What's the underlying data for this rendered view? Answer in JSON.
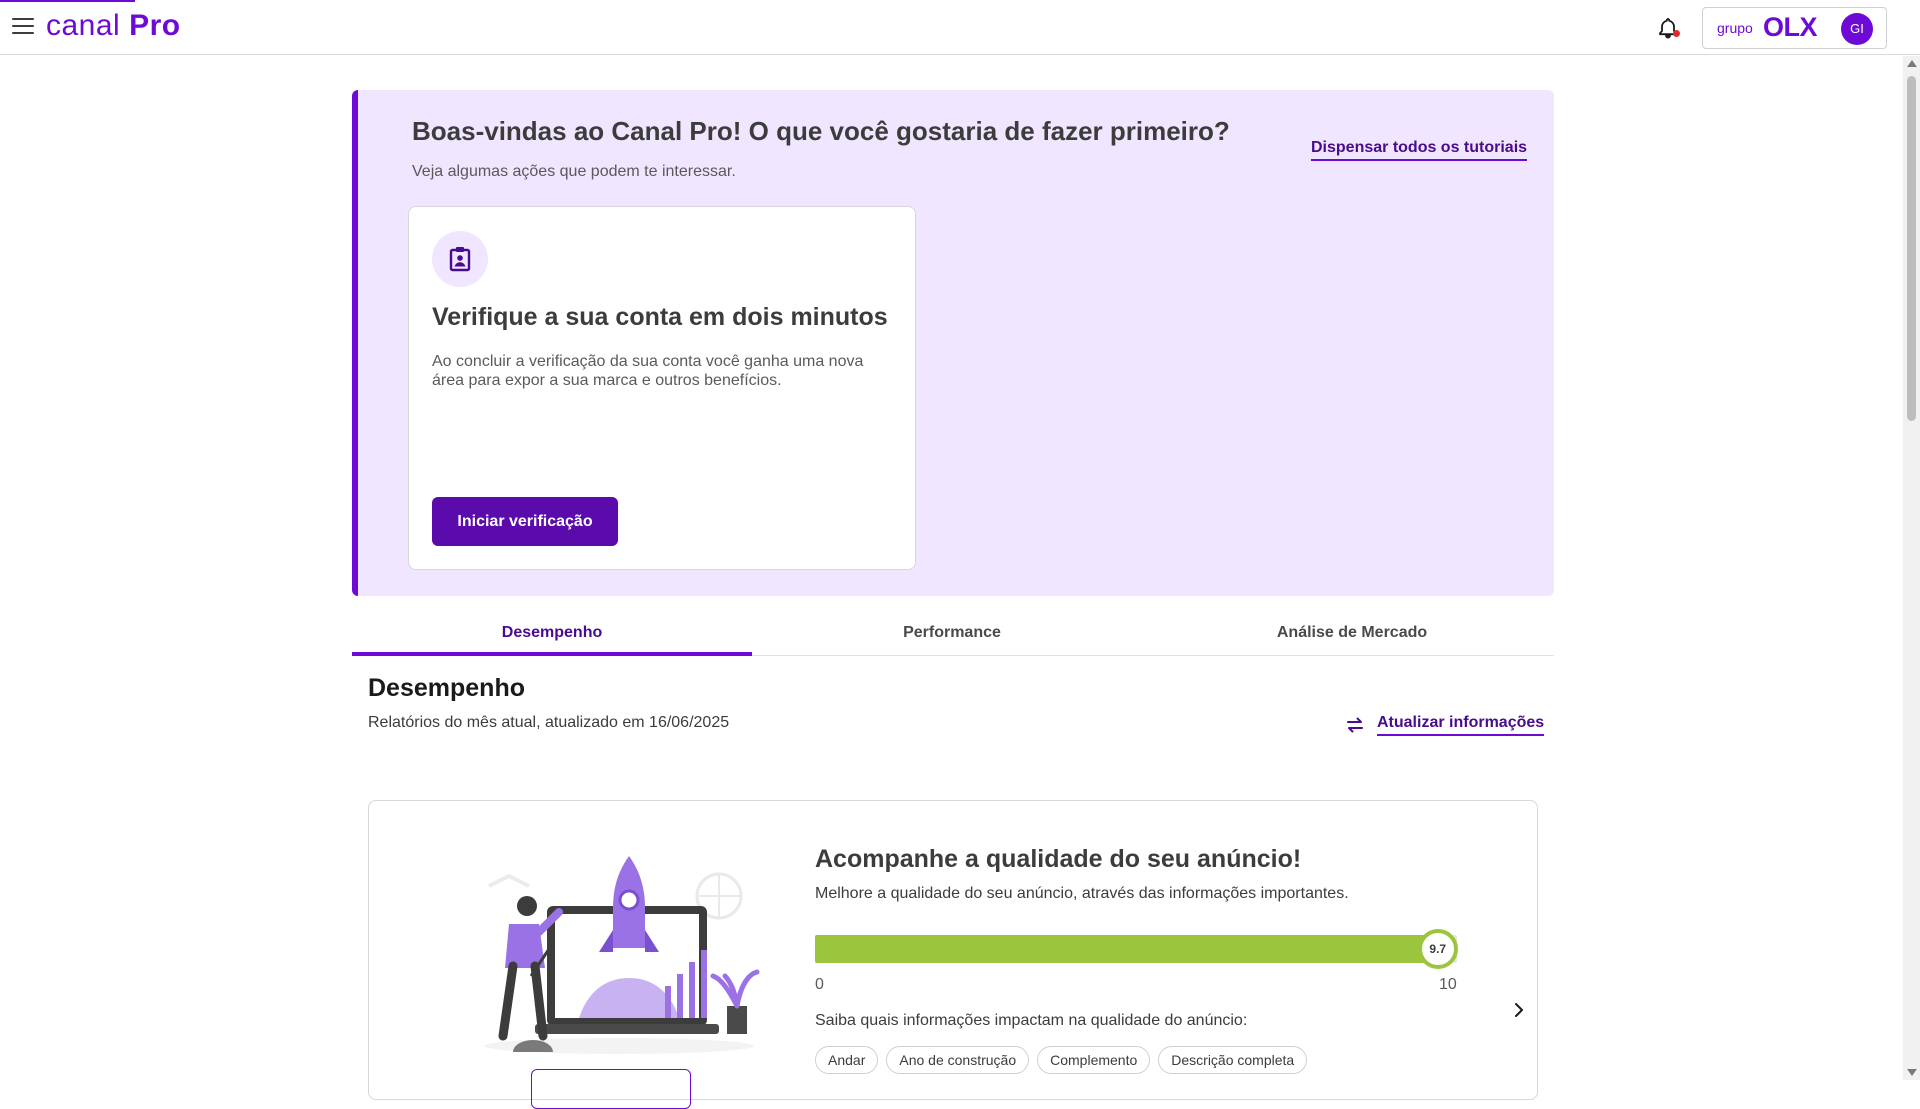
{
  "header": {
    "brand_light": "canal",
    "brand_bold": "Pro",
    "group_label": "grupo",
    "group_brand": "OLX",
    "avatar_initials": "GI",
    "icons": {
      "menu": "hamburger-icon",
      "notifications": "bell-icon"
    }
  },
  "welcome": {
    "title": "Boas-vindas ao Canal Pro! O que você gostaria de fazer primeiro?",
    "subtitle": "Veja algumas ações que podem te interessar.",
    "dismiss_label": "Dispensar todos os tutoriais",
    "card": {
      "icon": "badge-icon",
      "title": "Verifique a sua conta em dois minutos",
      "description": "Ao concluir a verificação da sua conta você ganha uma nova área para expor a sua marca e outros benefícios.",
      "button_label": "Iniciar verificação"
    }
  },
  "tabs": [
    {
      "label": "Desempenho",
      "active": true
    },
    {
      "label": "Performance",
      "active": false
    },
    {
      "label": "Análise de Mercado",
      "active": false
    }
  ],
  "performance": {
    "title": "Desempenho",
    "subtitle": "Relatórios do mês atual, atualizado em 16/06/2025",
    "refresh_label": "Atualizar informações"
  },
  "quality": {
    "title": "Acompanhe a qualidade do seu anúncio!",
    "subtitle": "Melhore a qualidade do seu anúncio, através das informações importantes.",
    "score": 9.7,
    "score_label": "9.7",
    "min_label": "0",
    "max_label": "10",
    "hint": "Saiba quais informações impactam na qualidade do anúncio:",
    "chips": [
      "Andar",
      "Ano de construção",
      "Complemento",
      "Descrição completa"
    ]
  },
  "colors": {
    "brand": "#6e0ad6",
    "brand_dark": "#5b0aab",
    "banner_bg": "#f0e6ff",
    "score_green": "#9bc53d",
    "notification_dot": "#e22a2a"
  }
}
